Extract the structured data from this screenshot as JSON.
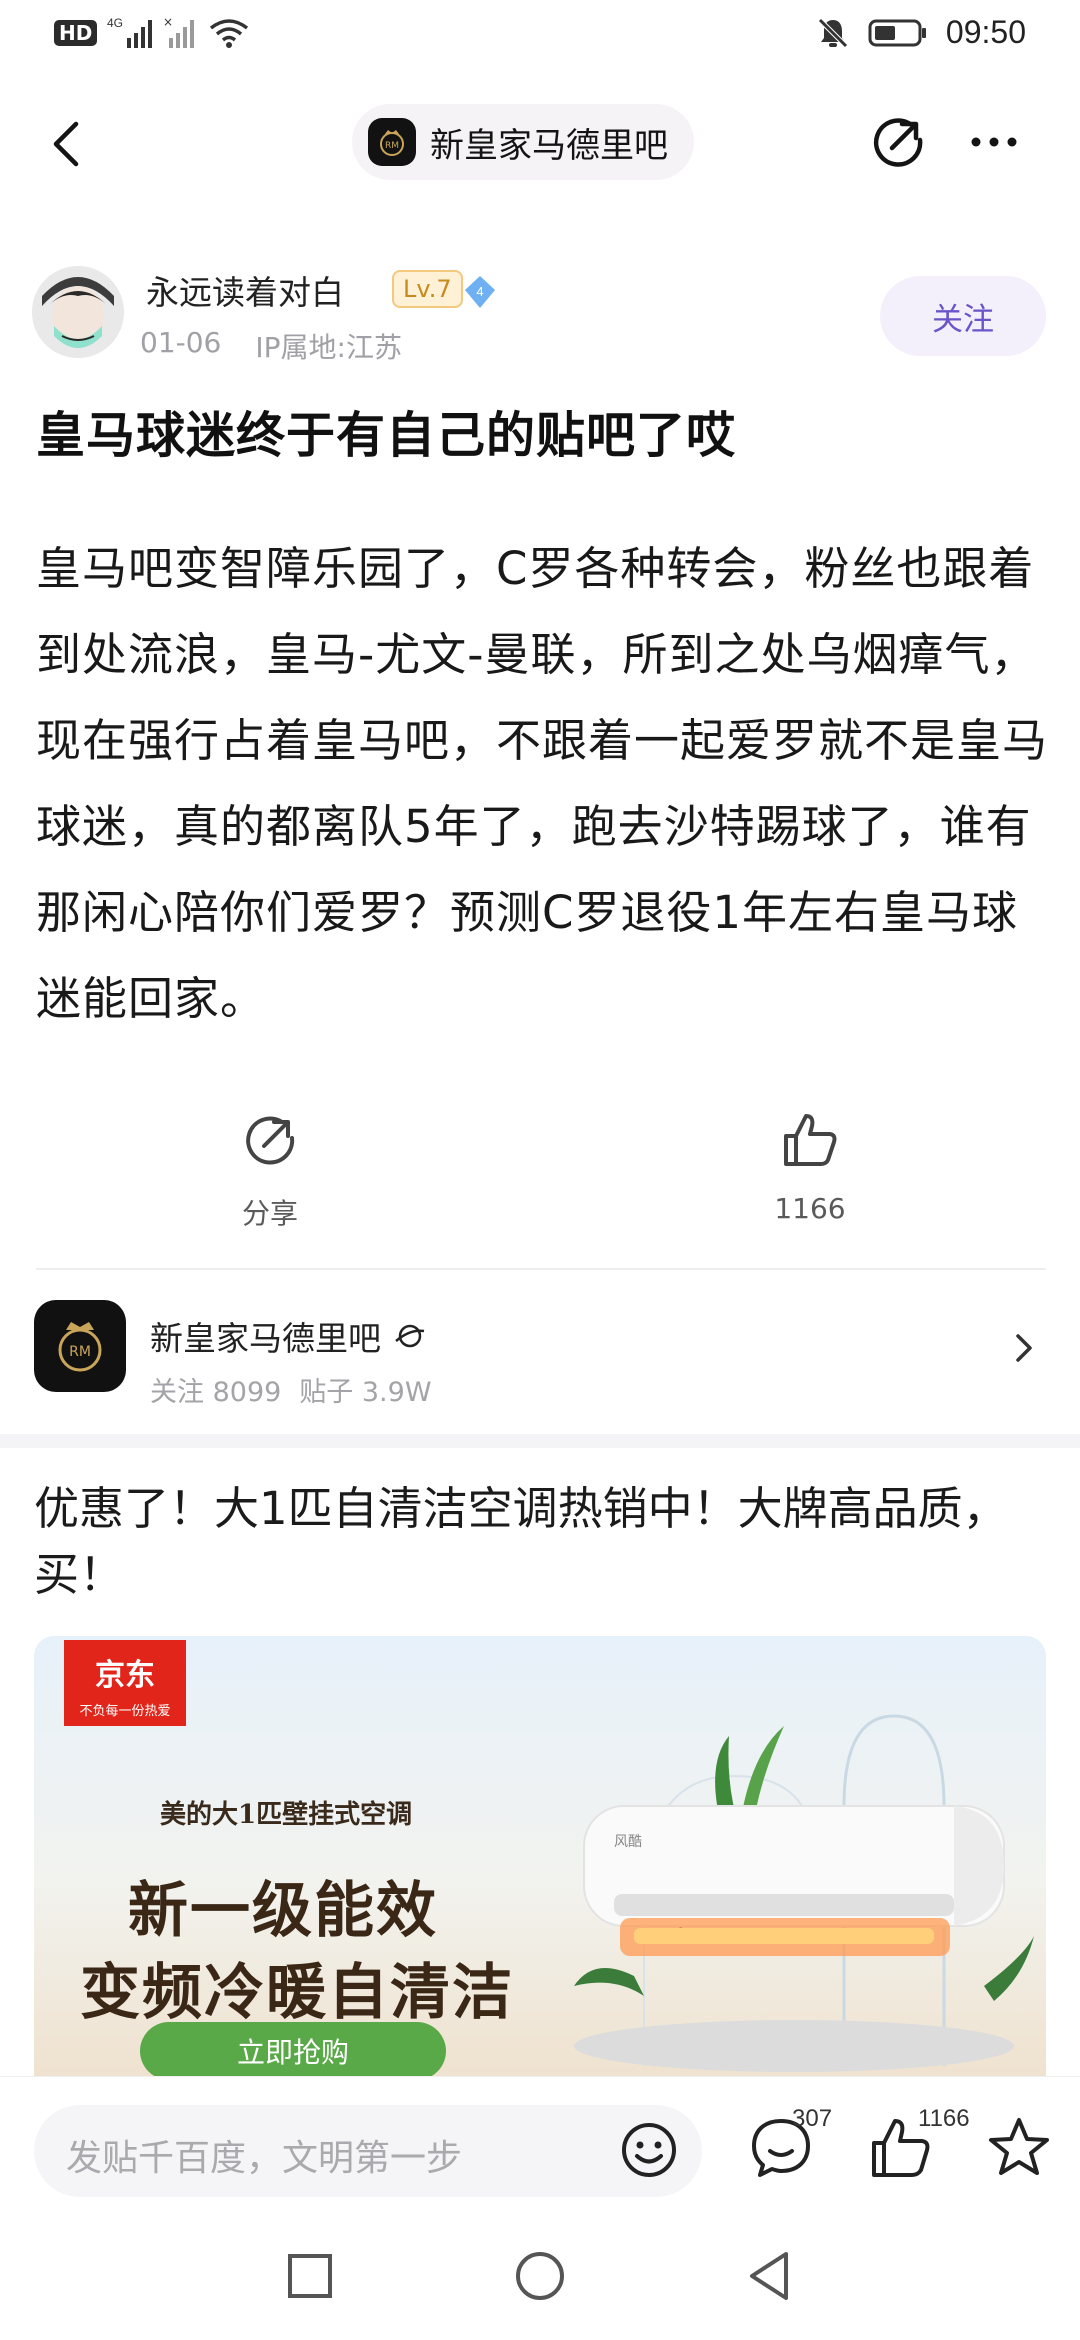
{
  "status_bar": {
    "network": "4G",
    "time": "09:50"
  },
  "nav": {
    "forum_name": "新皇家马德里吧"
  },
  "author": {
    "name": "永远读着对白",
    "level": "Lv.7",
    "vip_level": "4",
    "date": "01-06",
    "ip_location": "IP属地:江苏",
    "follow_label": "关注"
  },
  "post": {
    "title": "皇马球迷终于有自己的贴吧了哎",
    "body": "皇马吧变智障乐园了，C罗各种转会，粉丝也跟着到处流浪，皇马-尤文-曼联，所到之处乌烟瘴气，现在强行占着皇马吧，不跟着一起爱罗就不是皇马球迷，真的都离队5年了，跑去沙特踢球了，谁有那闲心陪你们爱罗？预测C罗退役1年左右皇马球迷能回家。"
  },
  "actions": {
    "share_label": "分享",
    "like_count": "1166"
  },
  "forum_card": {
    "name": "新皇家马德里吧",
    "followers": "关注 8099",
    "posts": "贴子 3.9W"
  },
  "ad": {
    "title": "优惠了！大1匹自清洁空调热销中！大牌高品质，买！",
    "brand": "京东",
    "brand_slogan": "不负每一份热爱",
    "subtitle": "美的大1匹壁挂式空调",
    "headline_1": "新一级能效",
    "headline_2": "变频冷暖自清洁",
    "cta": "立即抢购",
    "product_brand": "风酷"
  },
  "bottom_bar": {
    "input_placeholder": "发贴千百度，文明第一步",
    "comment_count": "307",
    "like_count": "1166"
  },
  "colors": {
    "accent": "#6a55c8",
    "level_badge": "#c88a1c",
    "jd_red": "#e1251b",
    "cta_green": "#5aa948"
  }
}
